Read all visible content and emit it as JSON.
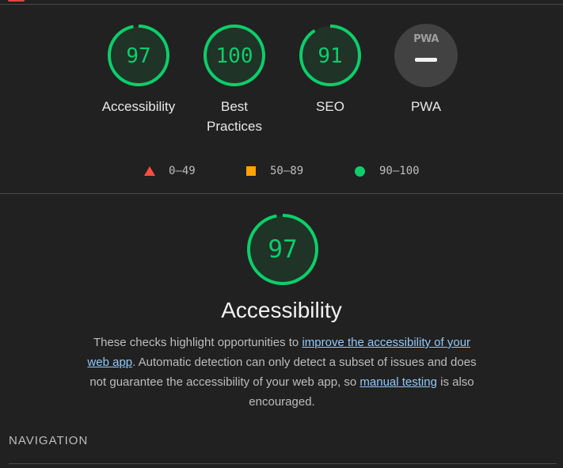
{
  "summary": {
    "gauges": [
      {
        "score": "97",
        "label": "Accessibility",
        "value": 97
      },
      {
        "score": "100",
        "label": "Best Practices",
        "value": 100
      },
      {
        "score": "91",
        "label": "SEO",
        "value": 91
      }
    ],
    "pwa": {
      "badge_text": "PWA",
      "label": "PWA"
    }
  },
  "legend": {
    "fail": "0–49",
    "average": "50–89",
    "pass": "90–100"
  },
  "category": {
    "score": "97",
    "value": 97,
    "title": "Accessibility",
    "description": {
      "part1": "These checks highlight opportunities to ",
      "link1": "improve the accessibility of your web app",
      "part2": ". Automatic detection can only detect a subset of issues and does not guarantee the accessibility of your web app, so ",
      "link2": "manual testing",
      "part3": " is also encouraged."
    }
  },
  "section": {
    "heading": "NAVIGATION"
  },
  "colors": {
    "pass": "#0cce6b",
    "average": "#ffa400",
    "fail": "#ff4e42",
    "background": "#212121",
    "link": "#90c8f8"
  }
}
